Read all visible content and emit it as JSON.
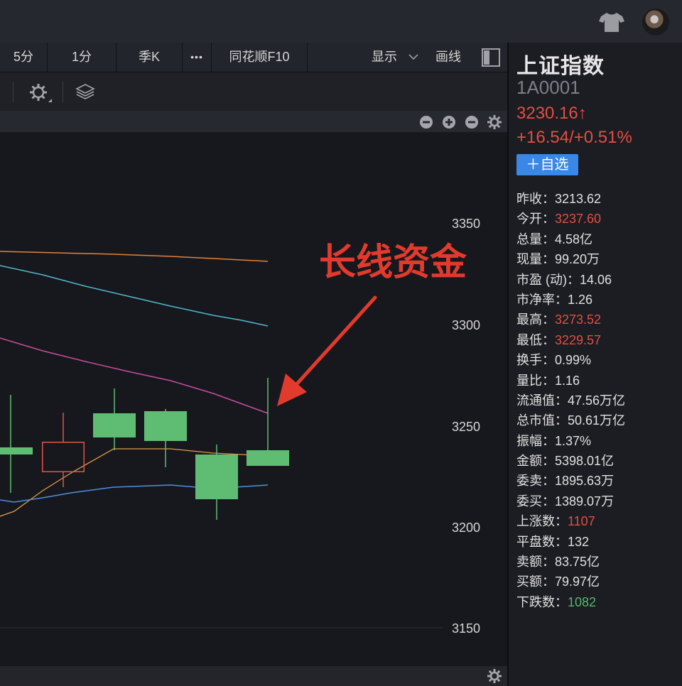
{
  "toolbar": {
    "period_5min": "5分",
    "period_1min": "1分",
    "period_quarter": "季K",
    "more": "•••",
    "f10": "同花顺F10",
    "display": "显示",
    "draw": "画线"
  },
  "chart": {
    "y_axis_ticks": [
      "3350",
      "3300",
      "3250",
      "3200",
      "3150"
    ],
    "annotation": "长线资金"
  },
  "stock": {
    "name": "上证指数",
    "code": "1A0001",
    "price": "3230.16↑",
    "change": "+16.54/+0.51%",
    "fav_button": "＋自选"
  },
  "stats": [
    {
      "label": "昨收：",
      "value": "3213.62",
      "color": "normal"
    },
    {
      "label": "今开：",
      "value": "3237.60",
      "color": "red"
    },
    {
      "label": "总量：",
      "value": "4.58亿",
      "color": "normal"
    },
    {
      "label": "现量：",
      "value": "99.20万",
      "color": "normal"
    },
    {
      "label": "市盈 (动)：",
      "value": "14.06",
      "color": "normal"
    },
    {
      "label": "市净率：",
      "value": "1.26",
      "color": "normal"
    },
    {
      "label": "最高：",
      "value": "3273.52",
      "color": "red"
    },
    {
      "label": "最低：",
      "value": "3229.57",
      "color": "red"
    },
    {
      "label": "换手：",
      "value": "0.99%",
      "color": "normal"
    },
    {
      "label": "量比：",
      "value": "1.16",
      "color": "normal"
    },
    {
      "label": "流通值：",
      "value": "47.56万亿",
      "color": "normal"
    },
    {
      "label": "总市值：",
      "value": "50.61万亿",
      "color": "normal"
    },
    {
      "label": "振幅：",
      "value": "1.37%",
      "color": "normal"
    },
    {
      "label": "金额：",
      "value": "5398.01亿",
      "color": "normal"
    },
    {
      "label": "委卖：",
      "value": "1895.63万",
      "color": "normal"
    },
    {
      "label": "委买：",
      "value": "1389.07万",
      "color": "normal"
    },
    {
      "label": "上涨数：",
      "value": "1107",
      "color": "red"
    },
    {
      "label": "平盘数：",
      "value": "132",
      "color": "normal"
    },
    {
      "label": "卖额：",
      "value": "83.75亿",
      "color": "normal"
    },
    {
      "label": "买额：",
      "value": "79.97亿",
      "color": "normal"
    },
    {
      "label": "下跌数：",
      "value": "1082",
      "color": "green"
    }
  ],
  "icons": {
    "shirt": "shirt-icon",
    "avatar": "avatar",
    "layout": "layout-toggle-icon",
    "settings": "gear-icon",
    "layers": "layers-icon",
    "zoom_out": "minus-circle-icon",
    "zoom_in": "plus-circle-icon",
    "collapse": "minus-circle-icon"
  },
  "colors": {
    "up": "#e54d42",
    "down": "#5fbd73",
    "accent": "#3b87e6",
    "ma_orange_long": "#e0843a",
    "ma_cyan": "#52b8d0",
    "ma_magenta": "#c84d9e",
    "ma_orange_short": "#e39a4a",
    "ma_blue": "#4f8fe0"
  }
}
